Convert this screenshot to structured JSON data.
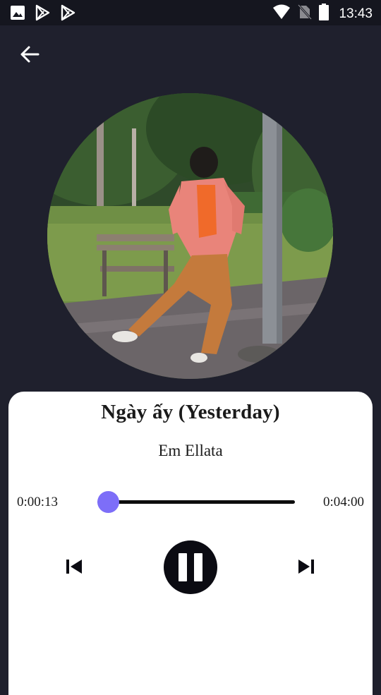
{
  "status_bar": {
    "time": "13:43",
    "left_icons": [
      "image-icon",
      "play-store-icon",
      "play-store-icon"
    ],
    "right_icons": [
      "wifi-icon",
      "no-sim-icon",
      "battery-icon"
    ]
  },
  "app_bar": {
    "back_icon": "arrow-left-icon"
  },
  "player": {
    "title": "Ngày ấy (Yesterday)",
    "artist": "Em Ellata",
    "elapsed": "0:00:13",
    "duration": "0:04:00",
    "progress": 0.054
  },
  "controls": {
    "previous_icon": "skip-previous-icon",
    "play_pause_icon": "pause-icon",
    "next_icon": "skip-next-icon"
  },
  "colors": {
    "background": "#1f202d",
    "status_bar": "#15161f",
    "card": "#ffffff",
    "accent": "#7d6ef8",
    "track": "#0c0c0c",
    "pause_button": "#0b0b12"
  }
}
